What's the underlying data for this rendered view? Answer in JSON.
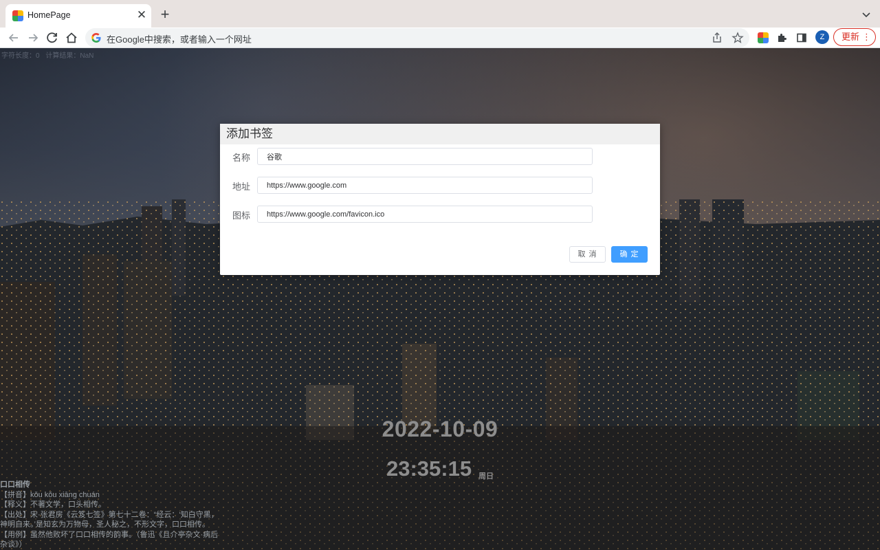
{
  "browser": {
    "tab_title": "HomePage",
    "tab_close": "✕",
    "new_tab": "+",
    "omnibox_placeholder": "在Google中搜索，或者输入一个网址",
    "avatar_letter": "Z",
    "update_label": "更新",
    "update_dots": "⋮"
  },
  "page": {
    "info_length_label": "字符长度：0",
    "info_result_label": "计算结果：NaN",
    "date": "2022-10-09",
    "time": "23:35:15",
    "weekday": "周日",
    "idiom": {
      "title": "口口相传",
      "pinyin": "【拼音】kǒu kǒu xiāng chuán",
      "meaning": "【释义】不著文学，口头相传。",
      "source": "【出处】宋·张君房《云笈七签》第七十二卷：“经云：‘知白守黑，神明自来。’是知玄为万物母，圣人秘之，不形文字，口口相传。",
      "example": "【用例】虽然他败坏了口口相传的韵事。（鲁迅《且介亭杂文·病后杂谈》）"
    }
  },
  "dialog": {
    "title": "添加书签",
    "fields": [
      {
        "label": "名称",
        "value": "谷歌"
      },
      {
        "label": "地址",
        "value": "https://www.google.com"
      },
      {
        "label": "图标",
        "value": "https://www.google.com/favicon.ico"
      }
    ],
    "cancel_label": "取 消",
    "ok_label": "确 定"
  },
  "colors": {
    "accent": "#409eff",
    "update_red": "#d93025"
  }
}
